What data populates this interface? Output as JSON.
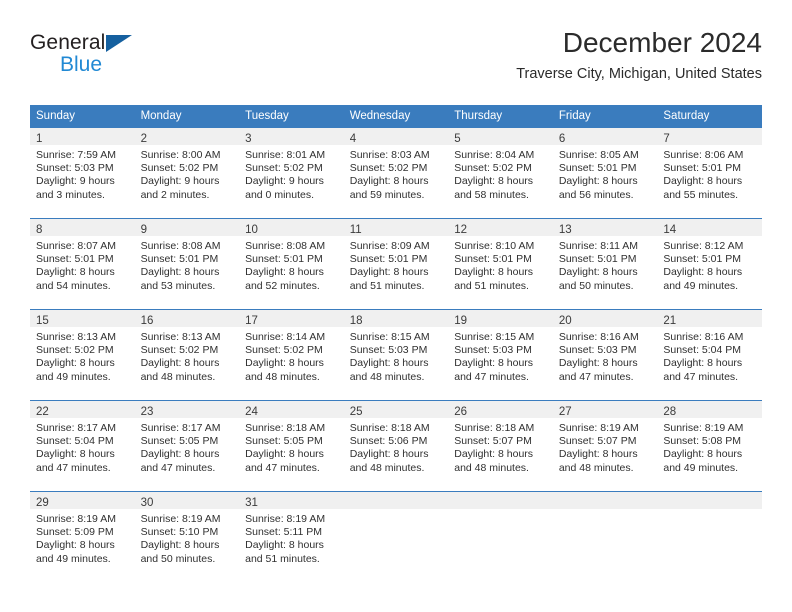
{
  "brand": {
    "line1": "General",
    "line2": "Blue",
    "flag_icon": "triangle-flag-icon"
  },
  "header": {
    "title": "December 2024",
    "subtitle": "Traverse City, Michigan, United States"
  },
  "colors": {
    "header_blue": "#3a7cbe",
    "brand_blue": "#2189d4",
    "flag_blue": "#15609f",
    "daynum_band": "#f0f0f0",
    "text": "#303030"
  },
  "weekdays": [
    "Sunday",
    "Monday",
    "Tuesday",
    "Wednesday",
    "Thursday",
    "Friday",
    "Saturday"
  ],
  "weeks": [
    [
      {
        "day": "1",
        "lines": [
          "Sunrise: 7:59 AM",
          "Sunset: 5:03 PM",
          "Daylight: 9 hours",
          "and 3 minutes."
        ]
      },
      {
        "day": "2",
        "lines": [
          "Sunrise: 8:00 AM",
          "Sunset: 5:02 PM",
          "Daylight: 9 hours",
          "and 2 minutes."
        ]
      },
      {
        "day": "3",
        "lines": [
          "Sunrise: 8:01 AM",
          "Sunset: 5:02 PM",
          "Daylight: 9 hours",
          "and 0 minutes."
        ]
      },
      {
        "day": "4",
        "lines": [
          "Sunrise: 8:03 AM",
          "Sunset: 5:02 PM",
          "Daylight: 8 hours",
          "and 59 minutes."
        ]
      },
      {
        "day": "5",
        "lines": [
          "Sunrise: 8:04 AM",
          "Sunset: 5:02 PM",
          "Daylight: 8 hours",
          "and 58 minutes."
        ]
      },
      {
        "day": "6",
        "lines": [
          "Sunrise: 8:05 AM",
          "Sunset: 5:01 PM",
          "Daylight: 8 hours",
          "and 56 minutes."
        ]
      },
      {
        "day": "7",
        "lines": [
          "Sunrise: 8:06 AM",
          "Sunset: 5:01 PM",
          "Daylight: 8 hours",
          "and 55 minutes."
        ]
      }
    ],
    [
      {
        "day": "8",
        "lines": [
          "Sunrise: 8:07 AM",
          "Sunset: 5:01 PM",
          "Daylight: 8 hours",
          "and 54 minutes."
        ]
      },
      {
        "day": "9",
        "lines": [
          "Sunrise: 8:08 AM",
          "Sunset: 5:01 PM",
          "Daylight: 8 hours",
          "and 53 minutes."
        ]
      },
      {
        "day": "10",
        "lines": [
          "Sunrise: 8:08 AM",
          "Sunset: 5:01 PM",
          "Daylight: 8 hours",
          "and 52 minutes."
        ]
      },
      {
        "day": "11",
        "lines": [
          "Sunrise: 8:09 AM",
          "Sunset: 5:01 PM",
          "Daylight: 8 hours",
          "and 51 minutes."
        ]
      },
      {
        "day": "12",
        "lines": [
          "Sunrise: 8:10 AM",
          "Sunset: 5:01 PM",
          "Daylight: 8 hours",
          "and 51 minutes."
        ]
      },
      {
        "day": "13",
        "lines": [
          "Sunrise: 8:11 AM",
          "Sunset: 5:01 PM",
          "Daylight: 8 hours",
          "and 50 minutes."
        ]
      },
      {
        "day": "14",
        "lines": [
          "Sunrise: 8:12 AM",
          "Sunset: 5:01 PM",
          "Daylight: 8 hours",
          "and 49 minutes."
        ]
      }
    ],
    [
      {
        "day": "15",
        "lines": [
          "Sunrise: 8:13 AM",
          "Sunset: 5:02 PM",
          "Daylight: 8 hours",
          "and 49 minutes."
        ]
      },
      {
        "day": "16",
        "lines": [
          "Sunrise: 8:13 AM",
          "Sunset: 5:02 PM",
          "Daylight: 8 hours",
          "and 48 minutes."
        ]
      },
      {
        "day": "17",
        "lines": [
          "Sunrise: 8:14 AM",
          "Sunset: 5:02 PM",
          "Daylight: 8 hours",
          "and 48 minutes."
        ]
      },
      {
        "day": "18",
        "lines": [
          "Sunrise: 8:15 AM",
          "Sunset: 5:03 PM",
          "Daylight: 8 hours",
          "and 48 minutes."
        ]
      },
      {
        "day": "19",
        "lines": [
          "Sunrise: 8:15 AM",
          "Sunset: 5:03 PM",
          "Daylight: 8 hours",
          "and 47 minutes."
        ]
      },
      {
        "day": "20",
        "lines": [
          "Sunrise: 8:16 AM",
          "Sunset: 5:03 PM",
          "Daylight: 8 hours",
          "and 47 minutes."
        ]
      },
      {
        "day": "21",
        "lines": [
          "Sunrise: 8:16 AM",
          "Sunset: 5:04 PM",
          "Daylight: 8 hours",
          "and 47 minutes."
        ]
      }
    ],
    [
      {
        "day": "22",
        "lines": [
          "Sunrise: 8:17 AM",
          "Sunset: 5:04 PM",
          "Daylight: 8 hours",
          "and 47 minutes."
        ]
      },
      {
        "day": "23",
        "lines": [
          "Sunrise: 8:17 AM",
          "Sunset: 5:05 PM",
          "Daylight: 8 hours",
          "and 47 minutes."
        ]
      },
      {
        "day": "24",
        "lines": [
          "Sunrise: 8:18 AM",
          "Sunset: 5:05 PM",
          "Daylight: 8 hours",
          "and 47 minutes."
        ]
      },
      {
        "day": "25",
        "lines": [
          "Sunrise: 8:18 AM",
          "Sunset: 5:06 PM",
          "Daylight: 8 hours",
          "and 48 minutes."
        ]
      },
      {
        "day": "26",
        "lines": [
          "Sunrise: 8:18 AM",
          "Sunset: 5:07 PM",
          "Daylight: 8 hours",
          "and 48 minutes."
        ]
      },
      {
        "day": "27",
        "lines": [
          "Sunrise: 8:19 AM",
          "Sunset: 5:07 PM",
          "Daylight: 8 hours",
          "and 48 minutes."
        ]
      },
      {
        "day": "28",
        "lines": [
          "Sunrise: 8:19 AM",
          "Sunset: 5:08 PM",
          "Daylight: 8 hours",
          "and 49 minutes."
        ]
      }
    ],
    [
      {
        "day": "29",
        "lines": [
          "Sunrise: 8:19 AM",
          "Sunset: 5:09 PM",
          "Daylight: 8 hours",
          "and 49 minutes."
        ]
      },
      {
        "day": "30",
        "lines": [
          "Sunrise: 8:19 AM",
          "Sunset: 5:10 PM",
          "Daylight: 8 hours",
          "and 50 minutes."
        ]
      },
      {
        "day": "31",
        "lines": [
          "Sunrise: 8:19 AM",
          "Sunset: 5:11 PM",
          "Daylight: 8 hours",
          "and 51 minutes."
        ]
      },
      {
        "day": "",
        "lines": []
      },
      {
        "day": "",
        "lines": []
      },
      {
        "day": "",
        "lines": []
      },
      {
        "day": "",
        "lines": []
      }
    ]
  ]
}
